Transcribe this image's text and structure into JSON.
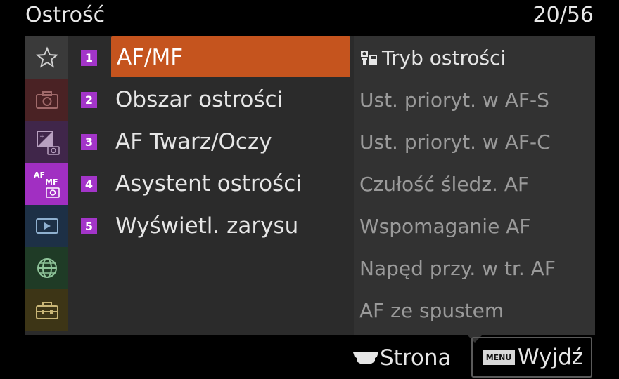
{
  "header": {
    "title": "Ostrość",
    "page_counter": "20/56"
  },
  "tabs": [
    {
      "name": "favorites",
      "icon": "star-icon",
      "color": "#3a3a3a"
    },
    {
      "name": "shooting",
      "icon": "camera-icon",
      "color": "#4a2224"
    },
    {
      "name": "exposure",
      "icon": "exposure-camera-icon",
      "color": "#40264a"
    },
    {
      "name": "af-mf",
      "icon": "af-mf-camera-icon",
      "label_top": "AF",
      "label_bottom": "MF",
      "color": "#a12fc2",
      "active": true
    },
    {
      "name": "playback",
      "icon": "playback-icon",
      "color": "#1d3046"
    },
    {
      "name": "network",
      "icon": "globe-icon",
      "color": "#1f3b26"
    },
    {
      "name": "setup",
      "icon": "toolbox-icon",
      "color": "#3d3516"
    }
  ],
  "menu": {
    "items": [
      {
        "number": "1",
        "label": "AF/MF",
        "selected": true
      },
      {
        "number": "2",
        "label": "Obszar ostrości"
      },
      {
        "number": "3",
        "label": "AF Twarz/Oczy"
      },
      {
        "number": "4",
        "label": "Asystent ostrości"
      },
      {
        "number": "5",
        "label": "Wyświetl. zarysu"
      }
    ]
  },
  "submenu": {
    "items": [
      {
        "label": "Tryb ostrości",
        "icon": "focus-mode-icon"
      },
      {
        "label": "Ust. prioryt. w AF-S"
      },
      {
        "label": "Ust. prioryt. w AF-C"
      },
      {
        "label": "Czułość śledz. AF"
      },
      {
        "label": "Wspomaganie AF"
      },
      {
        "label": "Napęd przy. w tr. AF"
      },
      {
        "label": "AF ze spustem"
      }
    ]
  },
  "footer": {
    "page_label": "Strona",
    "page_icon": "control-wheel-icon",
    "menu_badge": "MENU",
    "exit_label": "Wyjdź"
  },
  "colors": {
    "accent_selected": "#c5541e",
    "number_badge": "#a335c9",
    "panel": "#2b2b2b",
    "submenu_panel": "#323232"
  }
}
